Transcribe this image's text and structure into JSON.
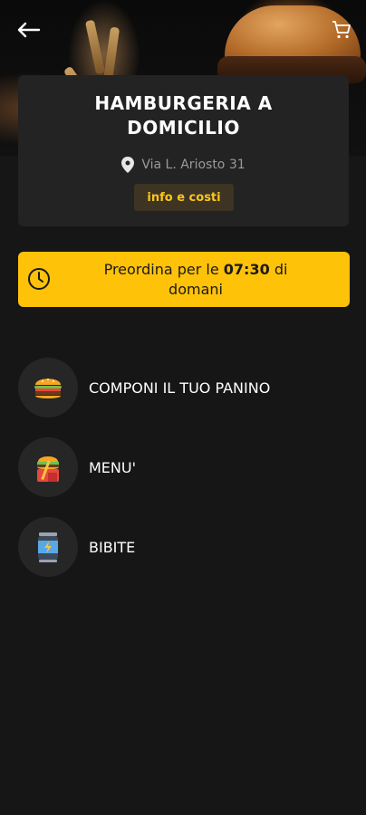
{
  "header": {
    "back_icon": "arrow-left-icon",
    "cart_icon": "cart-icon"
  },
  "shop": {
    "name_line1": "HAMBURGERIA A",
    "name_line2": "DOMICILIO",
    "address": "Via L. Ariosto 31",
    "info_button": "info e costi"
  },
  "preorder": {
    "prefix": "Preordina per le",
    "time": "07:30",
    "suffix": "di",
    "day": "domani"
  },
  "categories": [
    {
      "label": "COMPONI IL TUO PANINO",
      "icon": "burger-icon"
    },
    {
      "label": "MENU'",
      "icon": "burger-menu-icon"
    },
    {
      "label": "BIBITE",
      "icon": "drink-can-icon"
    }
  ],
  "colors": {
    "accent": "#fec209",
    "background": "#161616",
    "card": "#232323"
  }
}
